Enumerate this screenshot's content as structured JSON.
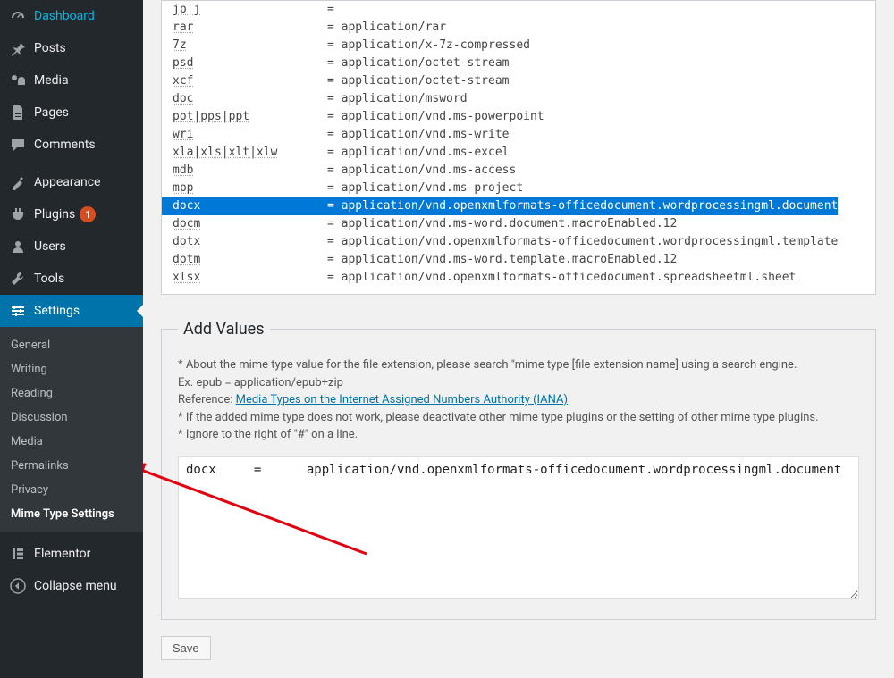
{
  "sidebar": {
    "items": [
      {
        "icon": "dashboard",
        "label": "Dashboard"
      },
      {
        "icon": "pin",
        "label": "Posts"
      },
      {
        "icon": "media",
        "label": "Media"
      },
      {
        "icon": "page",
        "label": "Pages"
      },
      {
        "icon": "comments",
        "label": "Comments"
      },
      {
        "icon": "appearance",
        "label": "Appearance"
      },
      {
        "icon": "plugin",
        "label": "Plugins",
        "badge": "1"
      },
      {
        "icon": "users",
        "label": "Users"
      },
      {
        "icon": "tools",
        "label": "Tools"
      },
      {
        "icon": "settings",
        "label": "Settings",
        "active": true
      }
    ],
    "settings_submenu": [
      "General",
      "Writing",
      "Reading",
      "Discussion",
      "Media",
      "Permalinks",
      "Privacy",
      "Mime Type Settings"
    ],
    "extra": [
      {
        "icon": "elementor",
        "label": "Elementor"
      },
      {
        "icon": "collapse",
        "label": "Collapse menu"
      }
    ]
  },
  "mime_list": [
    {
      "ext": "jp|j",
      "val": "="
    },
    {
      "ext": "rar",
      "val": "= application/rar"
    },
    {
      "ext": "7z",
      "val": "= application/x-7z-compressed"
    },
    {
      "ext": "psd",
      "val": "= application/octet-stream"
    },
    {
      "ext": "xcf",
      "val": "= application/octet-stream"
    },
    {
      "ext": "doc",
      "val": "= application/msword"
    },
    {
      "ext": "pot|pps|ppt",
      "val": "= application/vnd.ms-powerpoint"
    },
    {
      "ext": "wri",
      "val": "= application/vnd.ms-write"
    },
    {
      "ext": "xla|xls|xlt|xlw",
      "val": "= application/vnd.ms-excel"
    },
    {
      "ext": "mdb",
      "val": "= application/vnd.ms-access"
    },
    {
      "ext": "mpp",
      "val": "= application/vnd.ms-project"
    },
    {
      "ext": "docx",
      "val": "= application/vnd.openxmlformats-officedocument.wordprocessingml.document",
      "highlight": true
    },
    {
      "ext": "docm",
      "val": "= application/vnd.ms-word.document.macroEnabled.12"
    },
    {
      "ext": "dotx",
      "val": "= application/vnd.openxmlformats-officedocument.wordprocessingml.template"
    },
    {
      "ext": "dotm",
      "val": "= application/vnd.ms-word.template.macroEnabled.12"
    },
    {
      "ext": "xlsx",
      "val": "= application/vnd.openxmlformats-officedocument.spreadsheetml.sheet"
    }
  ],
  "addvalues": {
    "legend": "Add Values",
    "hint1": "* About the mime type value for the file extension, please search \"mime type [file extension name] using a search engine.",
    "hint2": "Ex. epub = application/epub+zip",
    "ref_label": "Reference: ",
    "ref_link": "Media Types on the Internet Assigned Numbers Authority (IANA)",
    "hint3": "* If the added mime type does not work, please deactivate other mime type plugins or the setting of other mime type plugins.",
    "hint4": "* Ignore to the right of \"#\" on a line.",
    "textarea_value": "docx     =      application/vnd.openxmlformats-officedocument.wordprocessingml.document"
  },
  "save_label": "Save"
}
